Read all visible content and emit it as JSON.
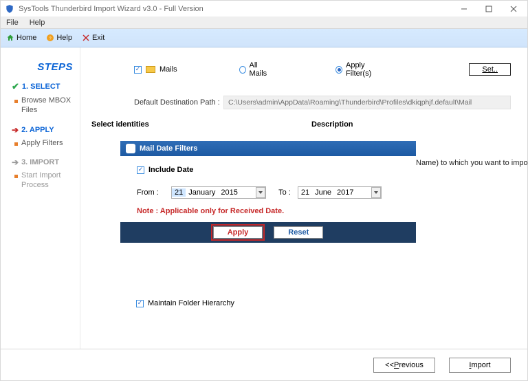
{
  "window": {
    "title": "SysTools Thunderbird Import Wizard v3.0 - Full Version"
  },
  "menubar": {
    "file": "File",
    "help": "Help"
  },
  "toolbar": {
    "home": "Home",
    "help": "Help",
    "exit": "Exit"
  },
  "sidebar": {
    "title": "STEPS",
    "step1": {
      "head": "1. SELECT",
      "sub": "Browse MBOX Files"
    },
    "step2": {
      "head": "2. APPLY",
      "sub": "Apply Filters"
    },
    "step3": {
      "head": "3. IMPORT",
      "sub": "Start Import Process"
    }
  },
  "top": {
    "mails_label": "Mails",
    "all_mails": "All Mails",
    "apply_filters": "Apply Filter(s)",
    "set": "Set.."
  },
  "path": {
    "label": "Default Destination Path :",
    "value": "C:\\Users\\admin\\AppData\\Roaming\\Thunderbird\\Profiles\\dkiqphjf.default\\Mail"
  },
  "ident": {
    "col1": "Select identities",
    "col2": "Description"
  },
  "dialog": {
    "title": "Mail Date Filters",
    "include": "Include Date",
    "from_lbl": "From :",
    "to_lbl": "To :",
    "from": {
      "d": "21",
      "m": "January",
      "y": "2015"
    },
    "to": {
      "d": "21",
      "m": "June",
      "y": "2017"
    },
    "note": "Note : Applicable only for Received Date.",
    "apply": "Apply",
    "reset": "Reset"
  },
  "helper": "Name) to  which  you want to import the Mbo",
  "maintain_label": "Maintain Folder Hierarchy",
  "bottom": {
    "prev_prefix": "<<",
    "prev_u": "P",
    "prev_rest": "revious",
    "imp_u": "I",
    "imp_rest": "mport"
  }
}
